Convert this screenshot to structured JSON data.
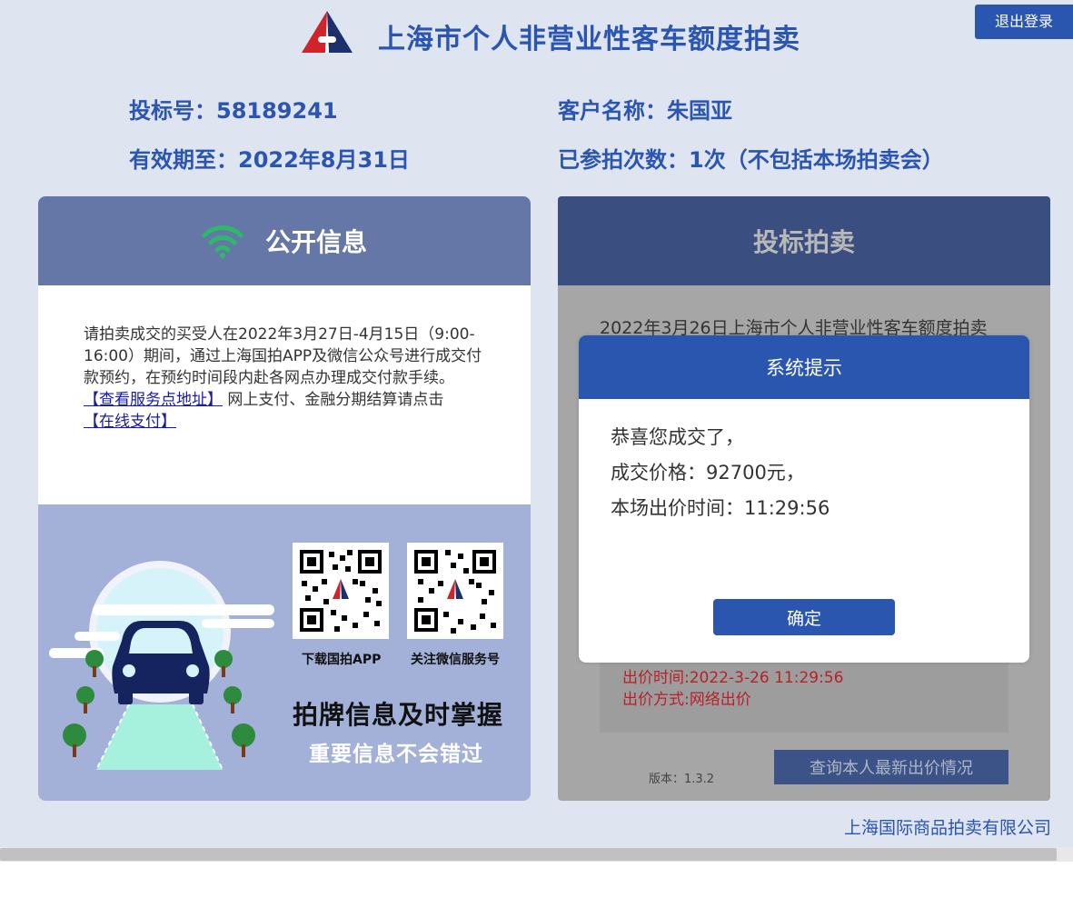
{
  "header": {
    "title": "上海市个人非营业性客车额度拍卖",
    "logout_label": "退出登录"
  },
  "bidder": {
    "bid_number_label": "投标号：",
    "bid_number": "58189241",
    "customer_label": "客户名称：",
    "customer_name": "朱国亚",
    "valid_until_label": "有效期至：",
    "valid_until": "2022年8月31日",
    "participation_label": "已参拍次数：",
    "participation": "1次（不包括本场拍卖会）"
  },
  "public_info": {
    "title": "公开信息",
    "notice_text": "请拍卖成交的买受人在2022年3月27日-4月15日（9:00-16:00）期间，通过上海国拍APP及微信公众号进行成交付款预约，在预约时间段内赴各网点办理成交付款手续。",
    "service_link": "【查看服务点地址】",
    "online_text": " 网上支付、金融分期结算请点击",
    "pay_link": "【在线支付】",
    "qr_app_caption": "下载国拍APP",
    "qr_wechat_caption": "关注微信服务号",
    "promo_title": "拍牌信息及时掌握",
    "promo_subtitle": "重要信息不会错过"
  },
  "bidding": {
    "title": "投标拍卖",
    "announcement": "2022年3月26日上海市个人非营业性客车额度拍卖",
    "bid_time": "出价时间:2022-3-26 11:29:56",
    "bid_method": "出价方式:网络出价",
    "version": "版本：1.3.2",
    "query_button": "查询本人最新出价情况"
  },
  "modal": {
    "title": "系统提示",
    "line1": "恭喜您成交了，",
    "line2": "成交价格：92700元，",
    "line3": "本场出价时间：11:29:56",
    "ok_label": "确定"
  },
  "footer": {
    "company": "上海国际商品拍卖有限公司"
  },
  "colors": {
    "brand_blue": "#2b56b0",
    "page_bg": "#dfe4f1",
    "wifi_green": "#2db86a",
    "bid_red": "#b8202a"
  },
  "icons": [
    "auction-logo-icon",
    "wifi-icon",
    "qr-code-icon",
    "car-illustration"
  ]
}
